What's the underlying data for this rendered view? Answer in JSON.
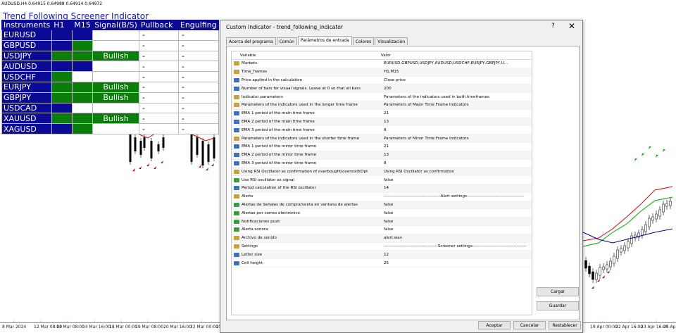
{
  "chart": {
    "title": "AUDUSD,H4  0.64915 0.64988 0.64914 0.64972",
    "time_labels": [
      "8 Mar 2024",
      "12 Mar 08:00",
      "13 Mar 08:00",
      "14 Mar 16:00",
      "18 Mar 00:00",
      "19 Mar 08:00",
      "20 Mar 16:00",
      "22 Mar 00:00",
      "25",
      "19 Apr 00:00",
      "22 Apr 16:00",
      "23 Apr 16:00",
      "25 Apr 00:00"
    ]
  },
  "screener": {
    "title": "Trend Following Screener Indicator",
    "headers": [
      "Instruments",
      "H1",
      "M15",
      "Signal(B/S)",
      "Pullback",
      "Engulfing"
    ],
    "rows": [
      {
        "inst": "EURUSD",
        "h1": "blue",
        "m15": "blue",
        "signal": "",
        "pullback": "-",
        "engulfing": "-"
      },
      {
        "inst": "GBPUSD",
        "h1": "blue",
        "m15": "green",
        "signal": "",
        "pullback": "-",
        "engulfing": "-"
      },
      {
        "inst": "USDJPY",
        "h1": "green",
        "m15": "green",
        "signal": "Bullish",
        "pullback": "-",
        "engulfing": "-"
      },
      {
        "inst": "AUDUSD",
        "h1": "blue",
        "m15": "blue",
        "signal": "",
        "pullback": "-",
        "engulfing": "-"
      },
      {
        "inst": "USDCHF",
        "h1": "green",
        "m15": "white",
        "signal": "",
        "pullback": "-",
        "engulfing": "-"
      },
      {
        "inst": "EURJPY",
        "h1": "green",
        "m15": "green",
        "signal": "Bullish",
        "pullback": "-",
        "engulfing": "-"
      },
      {
        "inst": "GBPJPY",
        "h1": "green",
        "m15": "green",
        "signal": "Bullish",
        "pullback": "-",
        "engulfing": "-"
      },
      {
        "inst": "USDCAD",
        "h1": "blue",
        "m15": "white",
        "signal": "",
        "pullback": "-",
        "engulfing": "-"
      },
      {
        "inst": "XAUUSD",
        "h1": "green",
        "m15": "green",
        "signal": "Bullish",
        "pullback": "-",
        "engulfing": "-"
      },
      {
        "inst": "XAGUSD",
        "h1": "blue",
        "m15": "green",
        "signal": "",
        "pullback": "-",
        "engulfing": "-"
      }
    ]
  },
  "dialog": {
    "title": "Custom Indicator - trend_following_indicator",
    "help": "?",
    "close": "✕",
    "tabs": [
      "Acerca del programa",
      "Común",
      "Parámetros de entrada",
      "Colores",
      "Visualización"
    ],
    "columns": {
      "variable": "Variable",
      "value": "Valor"
    },
    "params": [
      {
        "icon": "ab",
        "name": "Markets",
        "value": "EURUSD,GBPUSD,USDJPY,AUDUSD,USDCHF,EURJPY,GBPJPY,U..."
      },
      {
        "icon": "ab",
        "name": "Time_frames",
        "value": "H1,M15"
      },
      {
        "icon": "num",
        "name": "Price applied in the calculation",
        "value": "Close price"
      },
      {
        "icon": "num",
        "name": "Number of bars for visual signals. Leave at 0 so that all bars",
        "value": "200"
      },
      {
        "icon": "ab",
        "name": "Indicator parameters",
        "value": "Parameters of the indicators used in both timeframes"
      },
      {
        "icon": "ab",
        "name": "Parameters of the indicators used in the longer time frame",
        "value": "Parameters of Major Time Frame Indicators"
      },
      {
        "icon": "num",
        "name": "EMA 1 period of the main time frame",
        "value": "21"
      },
      {
        "icon": "num",
        "name": "EMA 2 period of the main time frame",
        "value": "13"
      },
      {
        "icon": "num",
        "name": "EMA 3 period of the main time frame",
        "value": "8"
      },
      {
        "icon": "ab",
        "name": "Parameters of the indicators used in the shorter time frame",
        "value": "Parameters of Minor Time Frame Indicators"
      },
      {
        "icon": "num",
        "name": "EMA 1 period of the minor time frame",
        "value": "21"
      },
      {
        "icon": "num",
        "name": "EMA 2 period of the minor time frame",
        "value": "13"
      },
      {
        "icon": "num",
        "name": "EMA 3 period of the minor time frame",
        "value": "8"
      },
      {
        "icon": "ab",
        "name": "Using RSI Oscillator as confirmation of overbought/oversold(Opt",
        "value": "Using RSI Oscillator as confirmation"
      },
      {
        "icon": "bool",
        "name": "Use RSI oscillator as signal",
        "value": "false"
      },
      {
        "icon": "num",
        "name": "Period calculation of the RSI oscillator",
        "value": "14"
      },
      {
        "icon": "ab",
        "name": "Alerts",
        "value": "----------------------------------------Alert settings----------------------------------------"
      },
      {
        "icon": "bool",
        "name": "Alertas de Señales de compra/venta en ventana de alertas",
        "value": "false"
      },
      {
        "icon": "bool",
        "name": "Alertas por correo electrónico",
        "value": "false"
      },
      {
        "icon": "bool",
        "name": "Notificaciones push",
        "value": "false"
      },
      {
        "icon": "bool",
        "name": "Alerta sonora",
        "value": "false"
      },
      {
        "icon": "ab",
        "name": "Archivo de sonido",
        "value": "alert.wav"
      },
      {
        "icon": "ab",
        "name": "Settings",
        "value": "--------------------------------------Screener settings--------------------------------------"
      },
      {
        "icon": "num",
        "name": "Letter size",
        "value": "12"
      },
      {
        "icon": "num",
        "name": "Cell height",
        "value": "25"
      }
    ],
    "load_label": "Cargar",
    "save_label": "Guardar",
    "accept_label": "Aceptar",
    "cancel_label": "Cancelar",
    "reset_label": "Restablecer"
  }
}
